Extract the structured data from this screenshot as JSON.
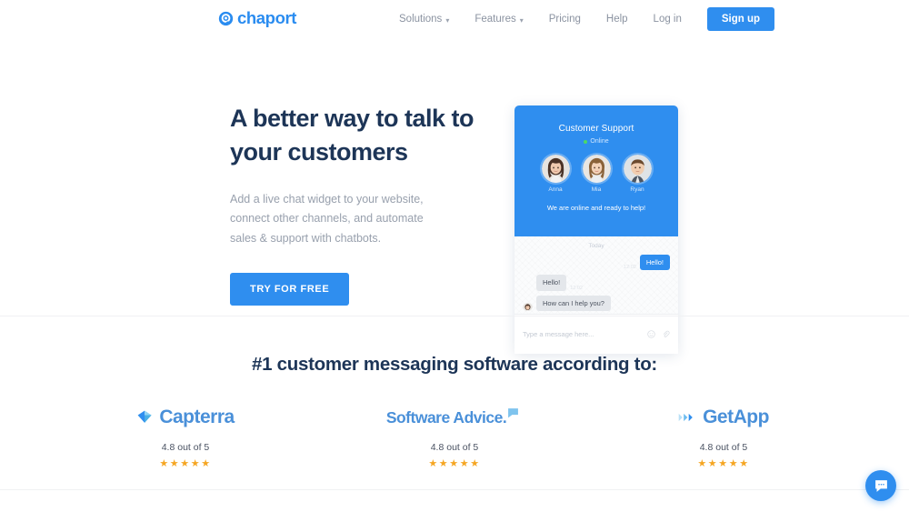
{
  "brand": {
    "name": "chaport",
    "accent": "#2f8eef",
    "heading_color": "#1d3557",
    "star_color": "#f5a623"
  },
  "header": {
    "logo_text": "chaport",
    "nav": [
      {
        "label": "Solutions",
        "has_caret": true
      },
      {
        "label": "Features",
        "has_caret": true
      },
      {
        "label": "Pricing",
        "has_caret": false
      },
      {
        "label": "Help",
        "has_caret": false
      },
      {
        "label": "Log in",
        "has_caret": false
      }
    ],
    "signup_label": "Sign up"
  },
  "hero": {
    "title_line1": "A better way to talk to",
    "title_line2": "your customers",
    "subtitle": "Add a live chat widget to your website, connect other channels, and automate sales & support with chatbots.",
    "cta_label": "TRY FOR FREE"
  },
  "widget": {
    "title": "Customer Support",
    "status": "Online",
    "agents": [
      {
        "name": "Anna"
      },
      {
        "name": "Mia"
      },
      {
        "name": "Ryan"
      }
    ],
    "ready_text": "We are online and ready to help!",
    "day_label": "Today",
    "messages": [
      {
        "direction": "out",
        "text": "Hello!",
        "stamp": "12:02"
      },
      {
        "direction": "in",
        "text": "Hello!",
        "stamp": "12:02"
      },
      {
        "direction": "in",
        "text": "How can I help you?",
        "stamp": ""
      }
    ],
    "input_placeholder": "Type a message here...",
    "foot_icons": [
      "emoji-icon",
      "attachment-icon"
    ]
  },
  "awards": {
    "title": "#1 customer messaging software according to:",
    "badges": [
      {
        "name": "Capterra",
        "icon": "capterra-arrow-icon",
        "score": "4.8 out of 5",
        "stars": "★★★★★"
      },
      {
        "name": "Software Advice.",
        "icon": "software-advice-bubble-icon",
        "score": "4.8 out of 5",
        "stars": "★★★★★"
      },
      {
        "name": "GetApp",
        "icon": "getapp-chevrons-icon",
        "score": "4.8 out of 5",
        "stars": "★★★★★"
      }
    ]
  },
  "launcher": {
    "icon": "chat-bubble-icon"
  }
}
